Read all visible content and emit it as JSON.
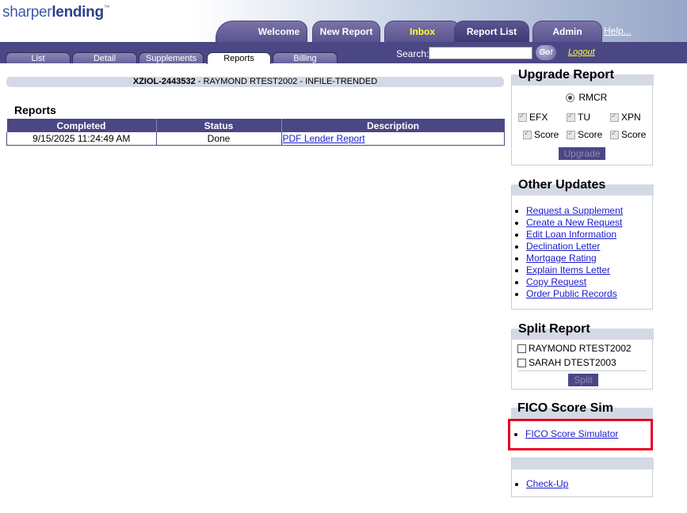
{
  "logo": {
    "part1": "sharper",
    "part2": "lending",
    "tm": "™"
  },
  "top_tabs": [
    "Welcome",
    "New Report",
    "Inbox",
    "Report List",
    "Admin"
  ],
  "help_label": "Help...",
  "sub_tabs": [
    "List",
    "Detail",
    "Supplements",
    "Reports",
    "Billing"
  ],
  "search": {
    "label": "Search:",
    "value": "",
    "placeholder": ""
  },
  "go_label": "Go!",
  "logout_label": "Logout",
  "record": {
    "id": "XZIOL-2443532",
    "rest": " - RAYMOND RTEST2002 - INFILE-TRENDED"
  },
  "reports": {
    "title": "Reports",
    "columns": [
      "Completed",
      "Status",
      "Description"
    ],
    "rows": [
      {
        "completed": "9/15/2025 11:24:49 AM",
        "status": "Done",
        "description": "PDF Lender Report"
      }
    ]
  },
  "upgrade": {
    "title": "Upgrade Report",
    "radio_label": "RMCR",
    "bureaus": [
      "EFX",
      "TU",
      "XPN"
    ],
    "score_label": "Score",
    "button": "Upgrade"
  },
  "other_updates": {
    "title": "Other Updates",
    "links": [
      "Request a Supplement",
      "Create a New Request",
      "Edit Loan Information",
      "Declination Letter",
      "Mortgage Rating",
      "Explain Items Letter",
      "Copy Request",
      "Order Public Records"
    ]
  },
  "split": {
    "title": "Split Report",
    "names": [
      "RAYMOND RTEST2002",
      "SARAH DTEST2003"
    ],
    "button": "Split"
  },
  "fico": {
    "title": "FICO Score Sim",
    "link": "FICO Score Simulator"
  },
  "checkup": {
    "link": "Check-Up"
  },
  "colors": {
    "nav": "#4b4785",
    "highlight": "#e8001c",
    "link": "#1a1acc",
    "inbox": "#ffff33"
  }
}
